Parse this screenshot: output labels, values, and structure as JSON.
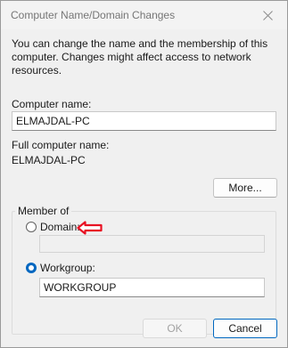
{
  "window": {
    "title": "Computer Name/Domain Changes"
  },
  "description": "You can change the name and the membership of this computer. Changes might affect access to network resources.",
  "computer_name": {
    "label": "Computer name:",
    "value": "ELMAJDAL-PC"
  },
  "full_computer_name": {
    "label": "Full computer name:",
    "value": "ELMAJDAL-PC"
  },
  "more_button": {
    "label": "More..."
  },
  "member_of": {
    "legend": "Member of",
    "domain": {
      "label": "Domain:",
      "selected": false,
      "value": ""
    },
    "workgroup": {
      "label": "Workgroup:",
      "selected": true,
      "value": "WORKGROUP"
    }
  },
  "annotation": {
    "icon": "red-arrow-left-icon",
    "color": "#e81123"
  },
  "footer": {
    "ok_label": "OK",
    "cancel_label": "Cancel"
  }
}
